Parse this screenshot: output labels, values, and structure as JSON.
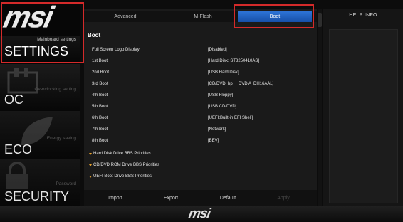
{
  "brand": {
    "logo_text": "msi",
    "footer_logo": "msi"
  },
  "sidebar": {
    "items": [
      {
        "id": "settings",
        "subtitle": "Mainboard settings",
        "label": "SETTINGS",
        "active": true
      },
      {
        "id": "oc",
        "subtitle": "Overclocking setting",
        "label": "OC",
        "active": false
      },
      {
        "id": "eco",
        "subtitle": "Energy saving",
        "label": "ECO",
        "active": false
      },
      {
        "id": "security",
        "subtitle": "Password",
        "label": "SECURITY",
        "active": false
      }
    ]
  },
  "tabs": [
    {
      "label": "Advanced",
      "active": false
    },
    {
      "label": "M-Flash",
      "active": false
    },
    {
      "label": "Boot",
      "active": true
    }
  ],
  "section_title": "Boot",
  "rows": [
    {
      "label": "Full Screen Logo Display",
      "value": "[Disabled]"
    },
    {
      "label": "1st Boot",
      "value": "[Hard Disk: ST3250410AS]"
    },
    {
      "label": "2nd Boot",
      "value": "[USB Hard Disk]"
    },
    {
      "label": "3rd Boot",
      "value": "[CD/DVD: hp     DVD A  DH16AAL]"
    },
    {
      "label": "4th Boot",
      "value": "[USB Floppy]"
    },
    {
      "label": "5th Boot",
      "value": "[USB CD/DVD]"
    },
    {
      "label": "6th Boot",
      "value": "[UEFI:Built-in EFI Shell]"
    },
    {
      "label": "7th Boot",
      "value": "[Network]"
    },
    {
      "label": "8th Boot",
      "value": "[BEV]"
    }
  ],
  "submenus": [
    {
      "label": "Hard Disk Drive BBS Priorities"
    },
    {
      "label": "CD/DVD ROM Drive BBS Priorities"
    },
    {
      "label": "UEFI Boot Drive BBS Priorities"
    }
  ],
  "bottom_buttons": [
    {
      "label": "Import",
      "enabled": true
    },
    {
      "label": "Export",
      "enabled": true
    },
    {
      "label": "Default",
      "enabled": true
    },
    {
      "label": "Apply",
      "enabled": false
    }
  ],
  "help": {
    "title": "HELP INFO"
  },
  "colors": {
    "accent_blue": "#2d73d6",
    "highlight_red": "#d42a2a",
    "arrow_orange": "#e7a12c"
  }
}
